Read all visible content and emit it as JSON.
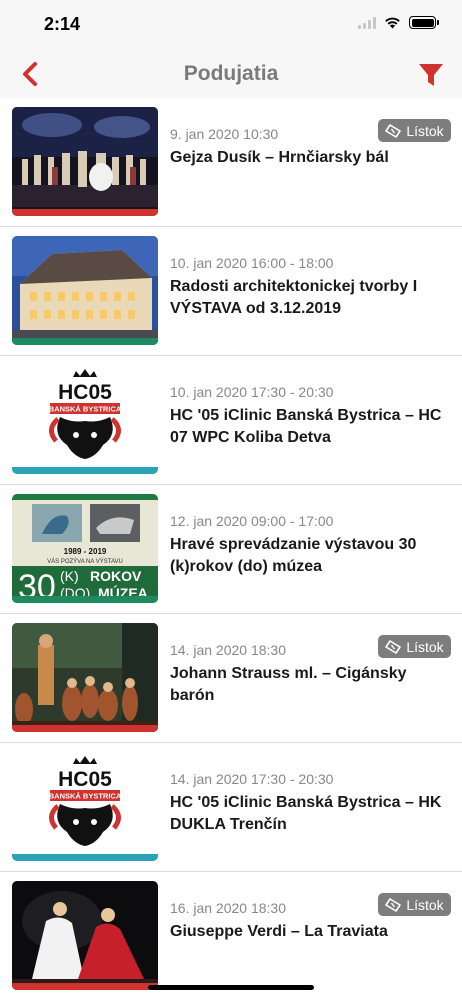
{
  "status": {
    "time": "2:14"
  },
  "nav": {
    "title": "Podujatia",
    "back_icon": "chevron-left-icon",
    "filter_icon": "filter-icon"
  },
  "colors": {
    "accent_red": "#d0332f",
    "teal": "#2aa3b8",
    "green": "#1f8a5f",
    "ticket_bg": "#7d7d7d"
  },
  "events": [
    {
      "date": "9. jan 2020 10:30",
      "title": "Gejza Dusík – Hrnčiarsky bál",
      "ticket": "Lístok",
      "image": "theatre-stage-photo",
      "stripe": "#d0332f"
    },
    {
      "date": "10. jan 2020 16:00 - 18:00",
      "title": "Radosti architektonickej tvorby I VÝSTAVA od 3.12.2019",
      "ticket": "",
      "image": "historic-building-photo",
      "stripe": "#1f8a5f"
    },
    {
      "date": "10. jan 2020 17:30 - 20:30",
      "title": "HC '05 iClinic Banská Bystrica – HC 07 WPC Koliba Detva",
      "ticket": "",
      "image": "hc05-logo",
      "stripe": "#2aa3b8",
      "logo": {
        "top": "HC05",
        "ribbon": "BANSKÁ BYSTRICA"
      }
    },
    {
      "date": "12. jan 2020 09:00 - 17:00",
      "title": "Hravé sprevádzanie výstavou 30 (k)rokov (do) múzea",
      "ticket": "",
      "image": "museum-poster",
      "stripe": "#1f8a5f",
      "poster": {
        "years": "1989 - 2019",
        "invite": "VÁS POZÝVA NA VÝSTAVU",
        "number": "30",
        "line1_a": "(K)",
        "line1_b": "ROKOV",
        "line2_a": "(DO)",
        "line2_b": "MÚZEA"
      }
    },
    {
      "date": "14. jan 2020 18:30",
      "title": "Johann Strauss ml. – Cigánsky barón",
      "ticket": "Lístok",
      "image": "opera-stage-photo",
      "stripe": "#d0332f"
    },
    {
      "date": "14. jan 2020 17:30 - 20:30",
      "title": "HC '05 iClinic Banská Bystrica – HK DUKLA Trenčín",
      "ticket": "",
      "image": "hc05-logo",
      "stripe": "#2aa3b8",
      "logo": {
        "top": "HC05",
        "ribbon": "BANSKÁ BYSTRICA"
      }
    },
    {
      "date": "16. jan 2020 18:30",
      "title": "Giuseppe Verdi – La Traviata",
      "ticket": "Lístok",
      "image": "la-traviata-photo",
      "stripe": "#d0332f"
    }
  ]
}
